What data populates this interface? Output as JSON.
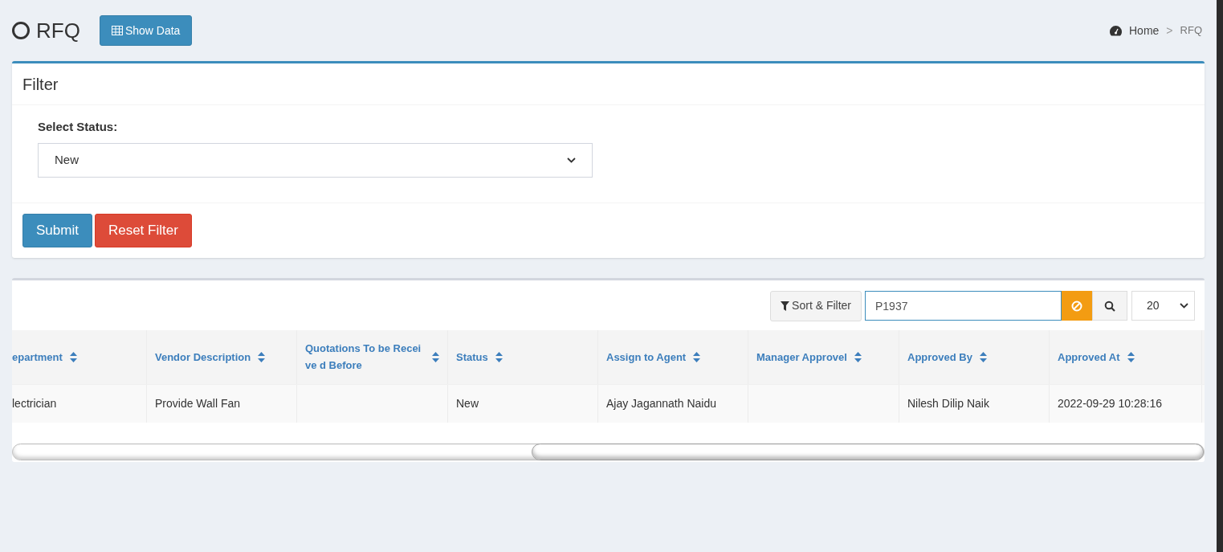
{
  "header": {
    "title": "RFQ",
    "show_data_button": "Show Data",
    "breadcrumb": [
      "Home",
      "RFQ"
    ],
    "breadcrumb_separator": ">"
  },
  "filter": {
    "title": "Filter",
    "status_label": "Select Status:",
    "status_value": "New",
    "buttons": [
      {
        "label": "Submit",
        "kind": "primary"
      },
      {
        "label": "Reset Filter",
        "kind": "danger"
      }
    ]
  },
  "toolbar": {
    "sort_filter_button": "Sort & Filter",
    "search_value": "P1937",
    "page_size": "20"
  },
  "table": {
    "columns": [
      {
        "label": "epartment"
      },
      {
        "label": "Vendor Description"
      },
      {
        "label": "Quotations To be Receive d Before"
      },
      {
        "label": "Status"
      },
      {
        "label": "Assign to Agent"
      },
      {
        "label": "Manager Approvel"
      },
      {
        "label": "Approved By"
      },
      {
        "label": "Approved At"
      }
    ],
    "rows": [
      [
        "lectrician",
        "Provide Wall Fan",
        "",
        "New",
        "Ajay Jagannath Naidu",
        "",
        "Nilesh Dilip Naik",
        "2022-09-29 10:28:16"
      ]
    ]
  }
}
